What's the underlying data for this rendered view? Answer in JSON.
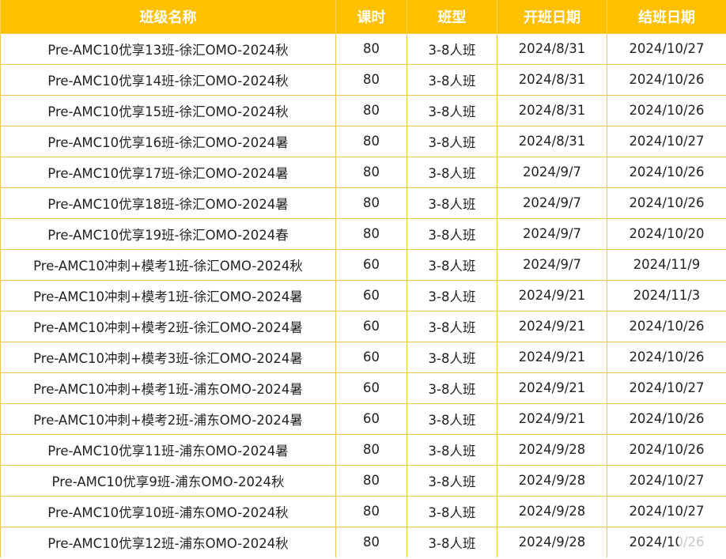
{
  "table": {
    "headers": [
      "班级名称",
      "课时",
      "班型",
      "开班日期",
      "结班日期"
    ],
    "rows": [
      [
        "Pre-AMC10优享13班-徐汇OMO-2024秋",
        "80",
        "3-8人班",
        "2024/8/31",
        "2024/10/27"
      ],
      [
        "Pre-AMC10优享14班-徐汇OMO-2024秋",
        "80",
        "3-8人班",
        "2024/8/31",
        "2024/10/26"
      ],
      [
        "Pre-AMC10优享15班-徐汇OMO-2024秋",
        "80",
        "3-8人班",
        "2024/8/31",
        "2024/10/26"
      ],
      [
        "Pre-AMC10优享16班-徐汇OMO-2024暑",
        "80",
        "3-8人班",
        "2024/8/31",
        "2024/10/27"
      ],
      [
        "Pre-AMC10优享17班-徐汇OMO-2024暑",
        "80",
        "3-8人班",
        "2024/9/7",
        "2024/10/26"
      ],
      [
        "Pre-AMC10优享18班-徐汇OMO-2024暑",
        "80",
        "3-8人班",
        "2024/9/7",
        "2024/10/26"
      ],
      [
        "Pre-AMC10优享19班-徐汇OMO-2024春",
        "80",
        "3-8人班",
        "2024/9/7",
        "2024/10/20"
      ],
      [
        "Pre-AMC10冲刺+模考1班-徐汇OMO-2024秋",
        "60",
        "3-8人班",
        "2024/9/7",
        "2024/11/9"
      ],
      [
        "Pre-AMC10冲刺+模考1班-徐汇OMO-2024暑",
        "60",
        "3-8人班",
        "2024/9/21",
        "2024/11/3"
      ],
      [
        "Pre-AMC10冲刺+模考2班-徐汇OMO-2024暑",
        "60",
        "3-8人班",
        "2024/9/21",
        "2024/10/26"
      ],
      [
        "Pre-AMC10冲刺+模考3班-徐汇OMO-2024暑",
        "60",
        "3-8人班",
        "2024/9/21",
        "2024/10/26"
      ],
      [
        "Pre-AMC10冲刺+模考1班-浦东OMO-2024暑",
        "60",
        "3-8人班",
        "2024/9/21",
        "2024/10/27"
      ],
      [
        "Pre-AMC10冲刺+模考2班-浦东OMO-2024暑",
        "60",
        "3-8人班",
        "2024/9/21",
        "2024/10/26"
      ],
      [
        "Pre-AMC10优享11班-浦东OMO-2024暑",
        "80",
        "3-8人班",
        "2024/9/28",
        "2024/10/26"
      ],
      [
        "Pre-AMC10优享9班-浦东OMO-2024秋",
        "80",
        "3-8人班",
        "2024/9/28",
        "2024/10/27"
      ],
      [
        "Pre-AMC10优享10班-浦东OMO-2024秋",
        "80",
        "3-8人班",
        "2024/9/28",
        "2024/10/27"
      ],
      [
        "Pre-AMC10优享12班-浦东OMO-2024秋",
        "80",
        "3-8人班",
        "2024/9/28",
        "2024/10/26"
      ]
    ]
  },
  "colors": {
    "header_background": "#ffc000",
    "header_text": "#ffffff",
    "grid_line": "#f2c64a",
    "cell_text": "#222222"
  }
}
